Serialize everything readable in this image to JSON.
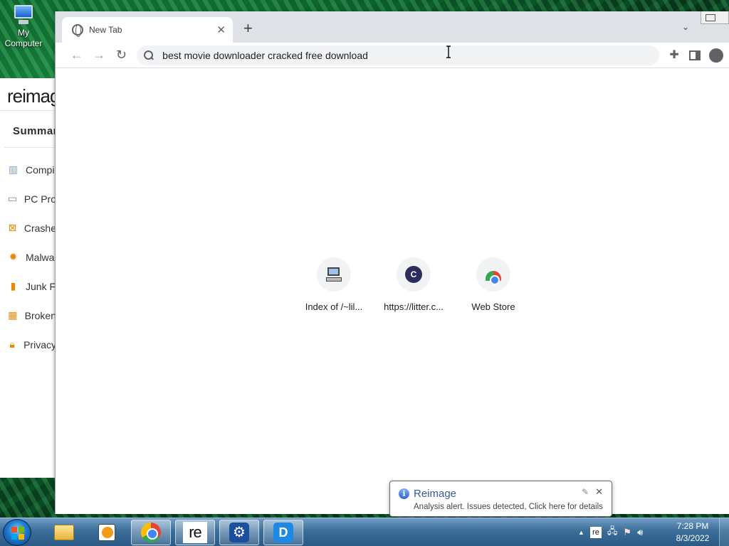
{
  "desktop": {
    "icon_label_line1": "My",
    "icon_label_line2": "Computer"
  },
  "reimage_window": {
    "logo": "reimag",
    "summary": "Summar",
    "items": [
      {
        "label": "Compi",
        "icon": "chart-icon"
      },
      {
        "label": "PC Pro",
        "icon": "pc-icon"
      },
      {
        "label": "Crashe",
        "icon": "crash-icon"
      },
      {
        "label": "Malwa",
        "icon": "bug-icon"
      },
      {
        "label": "Junk F",
        "icon": "trash-icon"
      },
      {
        "label": "Broken",
        "icon": "registry-icon"
      },
      {
        "label": "Privacy",
        "icon": "lock-icon"
      }
    ]
  },
  "browser": {
    "tab": {
      "title": "New Tab"
    },
    "omnibox": {
      "value": "best movie downloader cracked free download"
    },
    "shortcuts": [
      {
        "label": "Index of /~lil...",
        "icon": "computer-icon"
      },
      {
        "label": "https://litter.c...",
        "icon": "c-letter-icon",
        "letter": "C"
      },
      {
        "label": "Web Store",
        "icon": "webstore-icon"
      }
    ]
  },
  "notification": {
    "title": "Reimage",
    "message": "Analysis alert. Issues detected, Click here for details"
  },
  "taskbar": {
    "items": [
      "file-explorer",
      "media-player",
      "chrome",
      "reimage",
      "settings-tool",
      "d-app"
    ],
    "tray_app": "re",
    "clock_time": "7:28 PM",
    "clock_date": "8/3/2022"
  }
}
